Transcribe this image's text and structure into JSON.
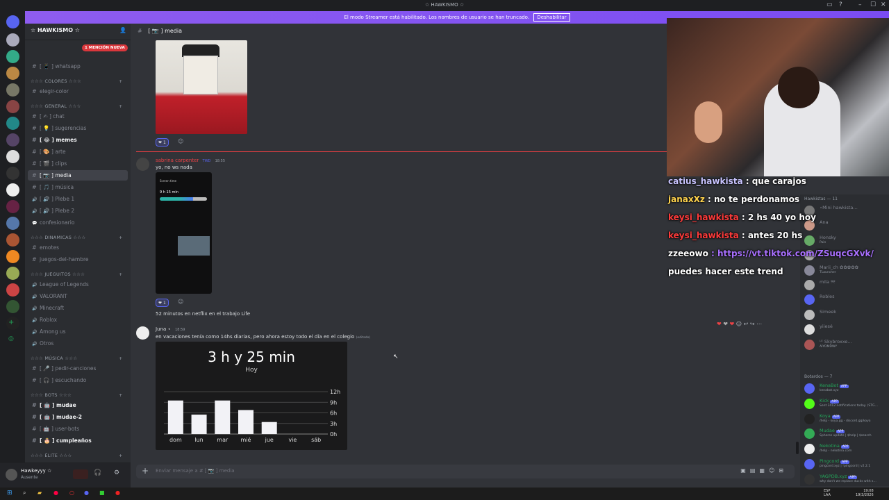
{
  "window": {
    "title": "☆ HAWKISMO ☆"
  },
  "banner": {
    "text": "El modo Streamer está habilitado. Los nombres de usuario se han truncado.",
    "button": "Deshabilitar"
  },
  "server": {
    "name": "☆ HAWKISMO ☆"
  },
  "mention_badge": "1 MENCIÓN NUEVA",
  "channels": [
    {
      "type": "text",
      "label": "[ 📱 ] whatsapp",
      "state": "normal"
    },
    {
      "type": "category",
      "label": "☆☆☆ COLORES ☆☆☆"
    },
    {
      "type": "text",
      "label": "elegir-color",
      "state": "normal"
    },
    {
      "type": "category",
      "label": "☆☆☆ GENERAL ☆☆☆"
    },
    {
      "type": "text",
      "label": "[ ✍ ] chat",
      "state": "normal"
    },
    {
      "type": "text",
      "label": "[ 💡 ] sugerencias",
      "state": "normal"
    },
    {
      "type": "text",
      "label": "[ 😂 ] memes",
      "state": "unread"
    },
    {
      "type": "text",
      "label": "[ 🎨 ] arte",
      "state": "normal"
    },
    {
      "type": "text",
      "label": "[ 🎬 ] clips",
      "state": "normal"
    },
    {
      "type": "text",
      "label": "[ 📷 ] media",
      "state": "selected"
    },
    {
      "type": "text",
      "label": "[ 🎵 ] música",
      "state": "normal"
    },
    {
      "type": "voice",
      "label": "[ 🔊 ] Plebe 1",
      "state": "normal"
    },
    {
      "type": "voice",
      "label": "[ 🔊 ] Plebe 2",
      "state": "normal"
    },
    {
      "type": "forum",
      "label": "confesionario",
      "state": "normal"
    },
    {
      "type": "category",
      "label": "☆☆☆ DINAMICAS ☆☆☆"
    },
    {
      "type": "text",
      "label": "emotes",
      "state": "normal"
    },
    {
      "type": "text",
      "label": "juegos-del-hambre",
      "state": "normal"
    },
    {
      "type": "category",
      "label": "☆☆☆ JUEGUITOS ☆☆☆"
    },
    {
      "type": "voice",
      "label": "League of Legends",
      "state": "normal"
    },
    {
      "type": "voice",
      "label": "VALORANT",
      "state": "normal"
    },
    {
      "type": "voice",
      "label": "Minecraft",
      "state": "normal"
    },
    {
      "type": "voice",
      "label": "Roblox",
      "state": "normal"
    },
    {
      "type": "voice",
      "label": "Among us",
      "state": "normal"
    },
    {
      "type": "voice",
      "label": "Otros",
      "state": "normal"
    },
    {
      "type": "category",
      "label": "☆☆☆ MÚSICA ☆☆☆"
    },
    {
      "type": "text",
      "label": "[ 🎤 ] pedir-canciones",
      "state": "normal"
    },
    {
      "type": "text",
      "label": "[ 🎧 ] escuchando",
      "state": "normal"
    },
    {
      "type": "category",
      "label": "☆☆☆ BOTS ☆☆☆"
    },
    {
      "type": "text",
      "label": "[ 🤖 ] mudae",
      "state": "unread"
    },
    {
      "type": "text",
      "label": "[ 🤖 ] mudae-2",
      "state": "unread"
    },
    {
      "type": "text",
      "label": "[ 🤖 ] user-bots",
      "state": "normal"
    },
    {
      "type": "text",
      "label": "[ 🎂 ] cumpleaños",
      "state": "unread"
    },
    {
      "type": "category",
      "label": "☆☆☆ ÉLITE ☆☆☆"
    }
  ],
  "user": {
    "name": "Hawkeyyy ☆",
    "status": "Ausente"
  },
  "header": {
    "channel": "[ 📷 ] media"
  },
  "messages": [
    {
      "author": "sabrina carpenter",
      "tag": "TWD",
      "time": "18:55",
      "text": "yo, no ws nada",
      "reaction_count": "1",
      "color": "#ed4245"
    },
    {
      "text": "52 minutos en netflix en el trabajo Life"
    },
    {
      "author": "Juna ⋆",
      "time": "18:59",
      "text": "en vacaciones tenía como 14hs diarias, pero ahora estoy todo el día en el colegio",
      "edited": "(editado)"
    }
  ],
  "first_reaction_count": "1",
  "phone_screen": {
    "title": "Screen time",
    "value": "9 h 15 min"
  },
  "screen_time_card": {
    "total": "3 h y 25 min",
    "label": "Hoy"
  },
  "chart_data": {
    "type": "bar",
    "categories": [
      "dom",
      "lun",
      "mar",
      "mié",
      "jue",
      "vie",
      "sáb"
    ],
    "values": [
      9.5,
      5.5,
      9.5,
      6.8,
      3.4,
      0,
      0
    ],
    "yticks": [
      "12h",
      "9h",
      "6h",
      "3h",
      "0h"
    ],
    "ylim": [
      0,
      12
    ]
  },
  "compose": {
    "placeholder": "Enviar mensaje a # [ 📷 ] media"
  },
  "members": {
    "group_hawkistas": "Hawkistas — 11",
    "list": [
      {
        "name": "⋆Mini hawkista…",
        "status": ""
      },
      {
        "name": "Ana",
        "status": ""
      },
      {
        "name": "Honsky",
        "status": "Pain"
      },
      {
        "name": "lulu!",
        "status": ""
      },
      {
        "name": "Marii_ch ✿✿✿✿✿",
        "status": "TLauncher"
      },
      {
        "name": "mila ୨୧",
        "status": ""
      },
      {
        "name": "Robles",
        "status": ""
      },
      {
        "name": "Simeek",
        "status": ""
      },
      {
        "name": "yiiesé",
        "status": ""
      },
      {
        "name": "ᴸᴱ Skybroxxe…",
        "status": "AIYDMDWY"
      }
    ],
    "group_bots": "Botardos — 7",
    "bots": [
      {
        "name": "KenaBot",
        "status": "kenabot.xyz"
      },
      {
        "name": "Kick",
        "status": "Sent 3412 notifications today. (STG…"
      },
      {
        "name": "Koya",
        "status": "/help - koya.gg - discord.gg/koya"
      },
      {
        "name": "Mudae",
        "status": "Spheres update | $help | $search"
      },
      {
        "name": "Nekotina",
        "status": "/help - nekotina.com"
      },
      {
        "name": "Pingcord",
        "status": "pingcord.xyz | !pingcord | v2.2.1"
      },
      {
        "name": "YAGPDB.xyz",
        "status": "why don't we replace ducks with s…"
      }
    ],
    "app_label": "APP"
  },
  "chat_overlay": [
    {
      "user": "catius_hawkista",
      "user_color": "#c9c4ff",
      "text": ": que carajos"
    },
    {
      "user": "janaxXz",
      "user_color": "#ffd34d",
      "text": ": no te perdonamos"
    },
    {
      "user": "keysi_hawkista",
      "user_color": "#ff3b3b",
      "text": ": 2 hs 40 yo hoy"
    },
    {
      "user": "keysi_hawkista",
      "user_color": "#ff3b3b",
      "text": ": antes 20 hs"
    },
    {
      "user": "zzeeowo",
      "user_color": "#ffffff",
      "text": ": https://vt.tiktok.com/ZSuqcGXvk/"
    },
    {
      "text": "puedes hacer este trend"
    }
  ],
  "taskbar": {
    "lang1": "ESP",
    "lang2": "LAA",
    "time": "19:08",
    "date": "19/3/2026"
  },
  "colors": {
    "accent": "#5865f2",
    "danger": "#f23f43",
    "bg": "#313338"
  }
}
